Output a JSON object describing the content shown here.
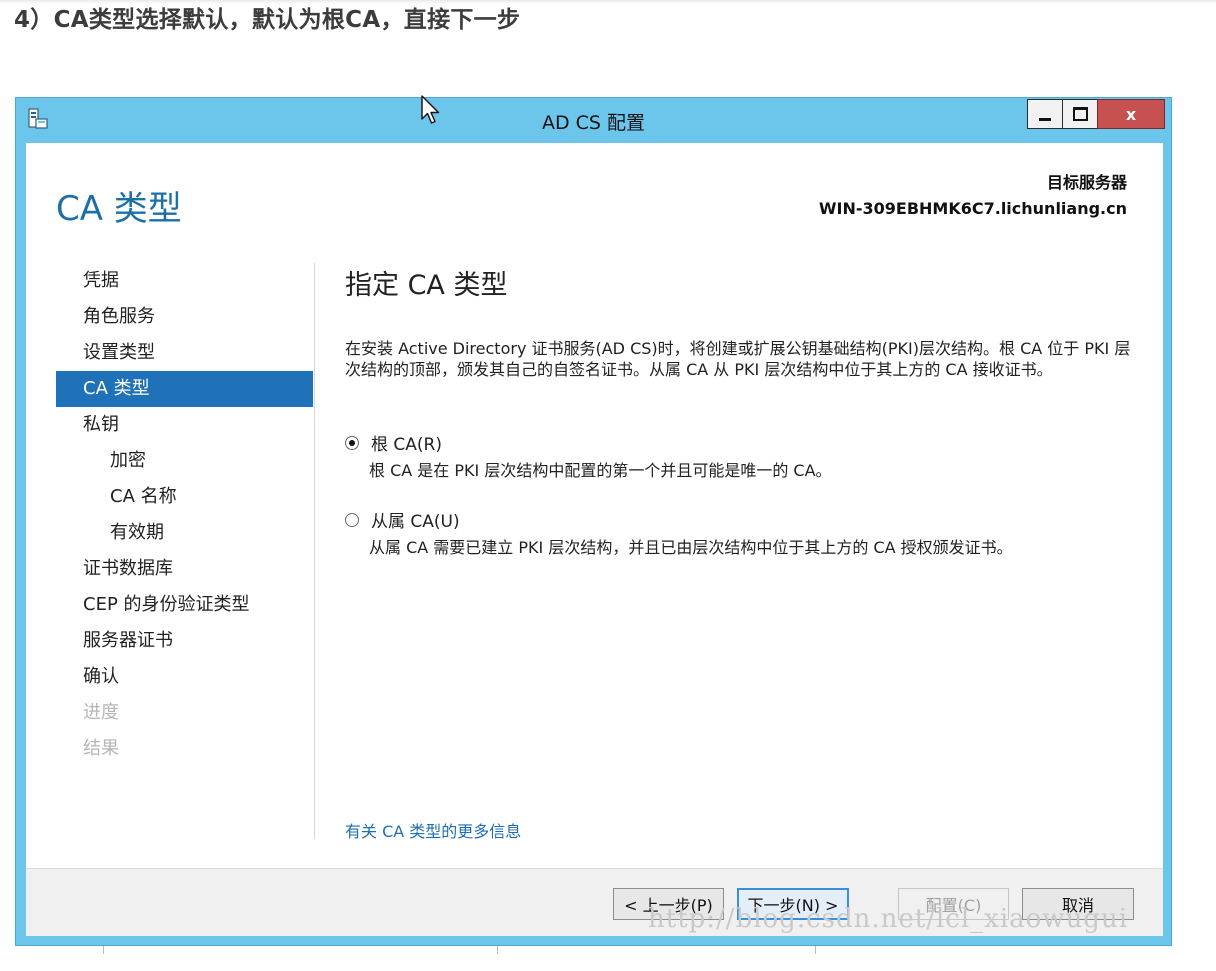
{
  "article": {
    "heading": "4）CA类型选择默认，默认为根CA，直接下一步",
    "watermark": "http://blog.csdn.net/lcl_xiaowugui"
  },
  "window": {
    "title": "AD CS 配置",
    "controls": {
      "minimize": "minimize",
      "maximize": "maximize",
      "close": "x"
    }
  },
  "header": {
    "page_title": "CA 类型",
    "target_label": "目标服务器",
    "target_value": "WIN-309EBHMK6C7.lichunliang.cn"
  },
  "nav": {
    "items": [
      {
        "label": "凭据"
      },
      {
        "label": "角色服务"
      },
      {
        "label": "设置类型"
      },
      {
        "label": "CA 类型"
      },
      {
        "label": "私钥"
      },
      {
        "label": "加密"
      },
      {
        "label": "CA 名称"
      },
      {
        "label": "有效期"
      },
      {
        "label": "证书数据库"
      },
      {
        "label": "CEP 的身份验证类型"
      },
      {
        "label": "服务器证书"
      },
      {
        "label": "确认"
      },
      {
        "label": "进度"
      },
      {
        "label": "结果"
      }
    ]
  },
  "main": {
    "section_title": "指定 CA 类型",
    "description": "在安装 Active Directory 证书服务(AD CS)时，将创建或扩展公钥基础结构(PKI)层次结构。根 CA 位于 PKI 层次结构的顶部，颁发其自己的自签名证书。从属 CA 从 PKI 层次结构中位于其上方的 CA 接收证书。",
    "options": [
      {
        "label": "根 CA(R)",
        "description": "根 CA 是在 PKI 层次结构中配置的第一个并且可能是唯一的 CA。",
        "selected": true
      },
      {
        "label": "从属 CA(U)",
        "description": "从属 CA 需要已建立 PKI 层次结构，并且已由层次结构中位于其上方的 CA 授权颁发证书。",
        "selected": false
      }
    ],
    "more_info_link": "有关 CA 类型的更多信息"
  },
  "footer": {
    "back": "< 上一步(P)",
    "next": "下一步(N) >",
    "configure": "配置(C)",
    "cancel": "取消"
  },
  "colors": {
    "window_frame": "#6cc6ec",
    "close_button": "#c75050",
    "title_accent": "#1d6fa5",
    "nav_active": "#1f72b8",
    "link": "#1f6fb3"
  }
}
